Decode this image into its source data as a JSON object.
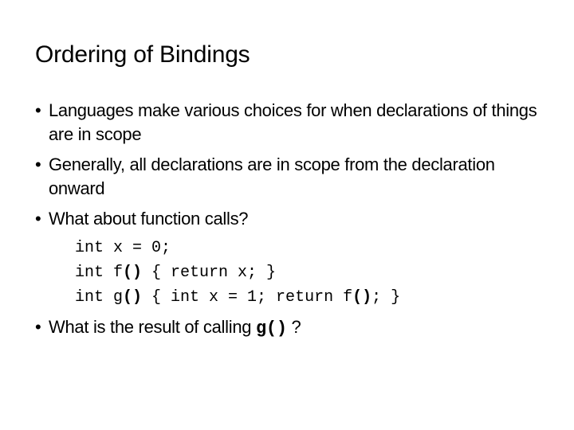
{
  "slide": {
    "title": "Ordering of Bindings",
    "bullet_symbol": "•",
    "bullets": [
      "Languages make various choices for when declarations of things are in scope",
      "Generally, all declarations are in scope from the declaration onward",
      "What about function calls?"
    ],
    "code": {
      "line1": "int x = 0;",
      "line2_a": "int f",
      "line2_p": "()",
      "line2_b": " { return x; }",
      "line3_a": "int g",
      "line3_p": "()",
      "line3_b": " { int x = 1; return f",
      "line3_p2": "()",
      "line3_c": "; }"
    },
    "last_bullet": {
      "text": "What is the result of calling ",
      "code": "g()",
      "suffix": " ?"
    }
  }
}
